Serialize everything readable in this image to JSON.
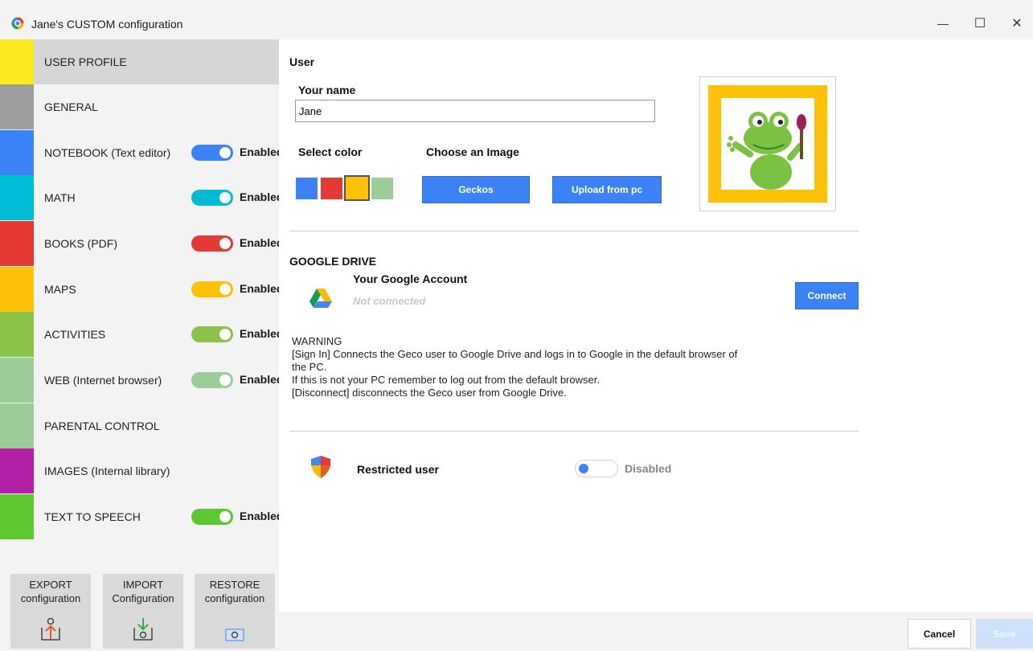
{
  "window": {
    "title": "Jane's CUSTOM configuration",
    "minimize_glyph": "—",
    "maximize_glyph": "☐",
    "close_glyph": "✕"
  },
  "sidebar": {
    "items": [
      {
        "label": "USER PROFILE",
        "color": "#fcea20",
        "toggle": false,
        "active": true
      },
      {
        "label": "GENERAL",
        "color": "#9e9e9e",
        "toggle": false
      },
      {
        "label": "NOTEBOOK (Text editor)",
        "color": "#3b82f6",
        "toggle": true,
        "toggle_color": "#3b82f6",
        "state": "Enabled"
      },
      {
        "label": "MATH",
        "color": "#00bcd4",
        "toggle": true,
        "toggle_color": "#00bcd4",
        "state": "Enabled"
      },
      {
        "label": "BOOKS (PDF)",
        "color": "#e53935",
        "toggle": true,
        "toggle_color": "#e53935",
        "state": "Enabled"
      },
      {
        "label": "MAPS",
        "color": "#ffc107",
        "toggle": true,
        "toggle_color": "#ffc107",
        "state": "Enabled"
      },
      {
        "label": "ACTIVITIES",
        "color": "#8bc34a",
        "toggle": true,
        "toggle_color": "#8bc34a",
        "state": "Enabled"
      },
      {
        "label": "WEB (Internet browser)",
        "color": "#9ccc98",
        "toggle": true,
        "toggle_color": "#9ccc98",
        "state": "Enabled"
      },
      {
        "label": "PARENTAL CONTROL",
        "color": "#9ccc98",
        "toggle": false
      },
      {
        "label": "IMAGES (Internal library)",
        "color": "#b01fa6",
        "toggle": false
      },
      {
        "label": "TEXT TO SPEECH",
        "color": "#5cc72e",
        "toggle": true,
        "toggle_color": "#5cc72e",
        "state": "Enabled"
      }
    ],
    "buttons": {
      "export_line1": "EXPORT",
      "export_line2": "configuration",
      "import_line1": "IMPORT",
      "import_line2": "Configuration",
      "restore_line1": "RESTORE",
      "restore_line2": "configuration"
    }
  },
  "user": {
    "section_title": "User",
    "name_label": "Your name",
    "name_value": "Jane",
    "select_color_label": "Select color",
    "choose_image_label": "Choose an Image",
    "swatches": [
      "#3b82f6",
      "#e53935",
      "#ffc107",
      "#9ccc98"
    ],
    "selected_color": "#ffc107",
    "geckos_button": "Geckos",
    "upload_button": "Upload from pc",
    "avatar_icon": "gecko-painter-avatar"
  },
  "google_drive": {
    "section_title": "GOOGLE DRIVE",
    "account_label": "Your Google Account",
    "status": "Not connected",
    "connect_button": "Connect",
    "warning_title": "WARNING",
    "warning_lines": [
      "[Sign In] Connects the Geco user to Google Drive and logs in to Google in the default browser of",
      "the PC.",
      "If this is not your PC remember to log out from the default browser.",
      "[Disconnect] disconnects the Geco user from Google Drive."
    ]
  },
  "restricted": {
    "label": "Restricted user",
    "state": "Disabled"
  },
  "footer": {
    "cancel": "Cancel",
    "save": "Save"
  }
}
